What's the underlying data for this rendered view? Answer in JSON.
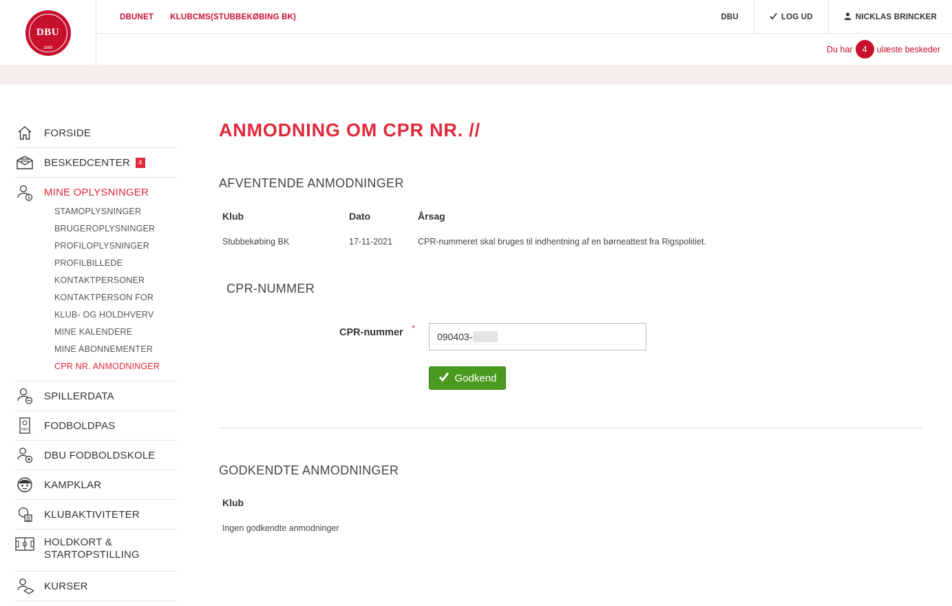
{
  "header": {
    "logo_text": "DBU",
    "logo_year": "1889",
    "nav_left": [
      "DBUNET",
      "KLUBCMS(STUBBEKØBING BK)"
    ],
    "nav_right": {
      "dbu": "DBU",
      "logout": "LOG UD",
      "user": "NICKLAS BRINCKER"
    },
    "messages": {
      "prefix": "Du har",
      "count": "4",
      "suffix": "ulæste beskeder"
    }
  },
  "sidebar": {
    "items": [
      {
        "label": "FORSIDE",
        "icon": "home-icon"
      },
      {
        "label": "BESKEDCENTER",
        "icon": "envelope-icon",
        "badge": "4"
      },
      {
        "label": "MINE OPLYSNINGER",
        "icon": "user-info-icon",
        "active": true
      },
      {
        "label": "SPILLERDATA",
        "icon": "player-icon"
      },
      {
        "label": "FODBOLDPAS",
        "icon": "passport-icon"
      },
      {
        "label": "DBU FODBOLDSKOLE",
        "icon": "school-icon"
      },
      {
        "label": "KAMPKLAR",
        "icon": "kampklar-icon"
      },
      {
        "label": "KLUBAKTIVITETER",
        "icon": "calendar-icon"
      },
      {
        "label": "HOLDKORT & STARTOPSTILLING",
        "icon": "pitch-icon"
      },
      {
        "label": "KURSER",
        "icon": "graduation-icon"
      }
    ],
    "subitems": [
      "STAMOPLYSNINGER",
      "BRUGEROPLYSNINGER",
      "PROFILOPLYSNINGER",
      "PROFILBILLEDE",
      "KONTAKTPERSONER",
      "KONTAKTPERSON FOR",
      "KLUB- OG HOLDHVERV",
      "MINE KALENDERE",
      "MINE ABONNEMENTER",
      "CPR NR. ANMODNINGER"
    ]
  },
  "main": {
    "title": "ANMODNING OM CPR NR. //",
    "pending": {
      "heading": "AFVENTENDE ANMODNINGER",
      "columns": [
        "Klub",
        "Dato",
        "Årsag"
      ],
      "rows": [
        [
          "Stubbekøbing BK",
          "17-11-2021",
          "CPR-nummeret skal bruges til indhentning af en børneattest fra Rigspolitiet."
        ]
      ]
    },
    "cpr": {
      "heading": "CPR-NUMMER",
      "label": "CPR-nummer",
      "required": "*",
      "value": "090403-",
      "button": "Godkend"
    },
    "approved": {
      "heading": "GODKENDTE ANMODNINGER",
      "columns": [
        "Klub"
      ],
      "empty": "Ingen godkendte anmodninger"
    }
  },
  "colors": {
    "brand_red": "#c8102e",
    "accent_red": "#e0283a",
    "button_green": "#4a9a1f"
  }
}
